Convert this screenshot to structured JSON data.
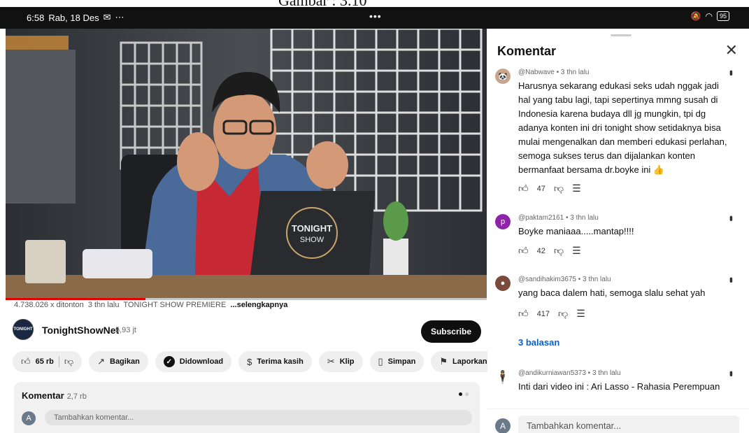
{
  "caption": "Gambar : 3.10",
  "status": {
    "time": "6:58",
    "date": "Rab, 18 Des",
    "center_dots": "•••",
    "battery": "95"
  },
  "video": {
    "laptop_text_1": "TONIGHT",
    "laptop_text_2": "SHOW",
    "progress": 0.29
  },
  "meta": {
    "views": "4.738.026 x ditonton",
    "age": "3 thn lalu",
    "tag": "TONIGHT SHOW PREMIERE",
    "more": "...selengkapnya"
  },
  "channel": {
    "name": "TonightShowNet",
    "subscribers": "5,93 jt",
    "subscribe": "Subscribe"
  },
  "actions": {
    "likes": "65 rb",
    "share": "Bagikan",
    "download": "Didownload",
    "thanks": "Terima kasih",
    "clip": "Klip",
    "save": "Simpan",
    "report": "Laporkan"
  },
  "teaser": {
    "title": "Komentar",
    "count": "2,7 rb",
    "avatar_letter": "A",
    "placeholder": "Tambahkan komentar..."
  },
  "panel": {
    "title": "Komentar",
    "comments": [
      {
        "author": "@Nabwave • 3 thn lalu",
        "text": "Harusnya sekarang edukasi seks udah nggak jadi hal yang tabu lagi, tapi sepertinya mmng susah di Indonesia karena budaya dll jg mungkin, tpi dg adanya konten ini dri tonight show setidaknya bisa mulai mengenalkan dan memberi edukasi perlahan, semoga sukses terus dan dijalankan konten bermanfaat bersama dr.boyke ini 👍",
        "likes": "47"
      },
      {
        "author": "@paktam2161 • 3 thn lalu",
        "avatar_letter": "p",
        "text": "Boyke maniaaa.....mantap!!!!",
        "likes": "42"
      },
      {
        "author": "@sandihakim3675 • 3 thn lalu",
        "text": "yang baca dalem hati, semoga slalu sehat yah",
        "likes": "417",
        "replies": "3 balasan"
      },
      {
        "author": "@andikurniawan5373 • 3 thn lalu",
        "text": "Inti dari video ini : Ari Lasso - Rahasia Perempuan"
      }
    ],
    "input_avatar": "A",
    "input_placeholder": "Tambahkan komentar..."
  },
  "colors": {
    "subscribe_bg": "#0f0f0f",
    "progress": "#e00000",
    "link": "#065fd4",
    "avatar_p": "#8e24aa"
  }
}
